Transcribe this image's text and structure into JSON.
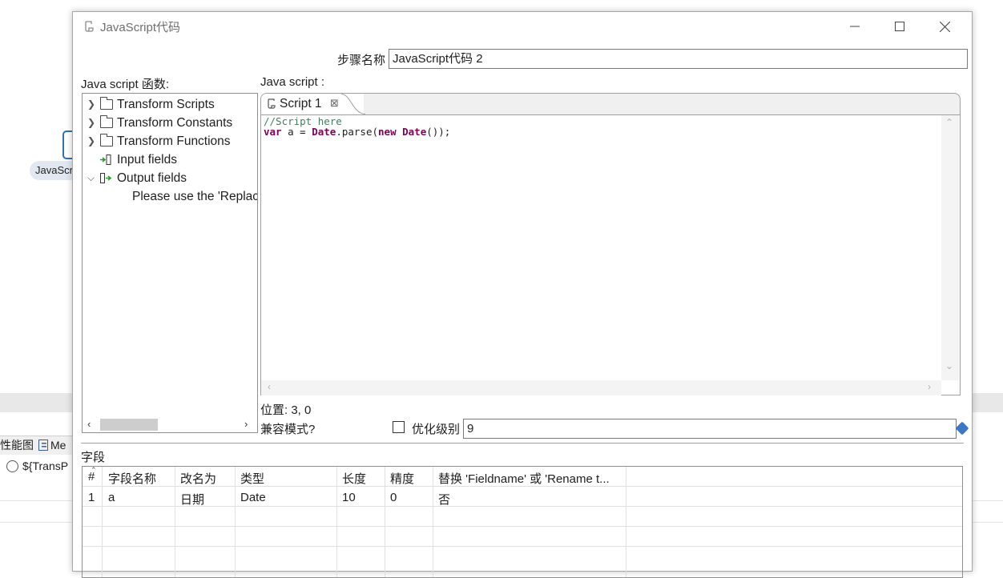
{
  "background": {
    "step_label": "JavaScript代码",
    "tab_label": "性能图",
    "tab2_label": "Me",
    "run_row_label": "${TransP"
  },
  "dialog": {
    "title": "JavaScript代码",
    "step_name_label": "步骤名称",
    "step_name_value": "JavaScript代码 2",
    "functions_label": "Java script 函数:",
    "javascript_label": "Java script :",
    "tree": {
      "items": [
        {
          "label": "Transform Scripts",
          "icon": "folder-icon",
          "expanded": false
        },
        {
          "label": "Transform Constants",
          "icon": "folder-icon",
          "expanded": false
        },
        {
          "label": "Transform Functions",
          "icon": "folder-icon",
          "expanded": false
        },
        {
          "label": "Input fields",
          "icon": "input-fields-icon"
        },
        {
          "label": "Output fields",
          "icon": "output-fields-icon",
          "expanded": true
        },
        {
          "label": "Please use the 'Replac"
        }
      ]
    },
    "editor": {
      "tab_label": "Script 1",
      "code_comment": "//Script here",
      "code_kw1": "var",
      "code_mid1": " a = ",
      "code_obj1": "Date",
      "code_mid2": ".parse(",
      "code_kw2": "new",
      "code_sp": " ",
      "code_obj2": "Date",
      "code_end": "());"
    },
    "position_text": "位置: 3, 0",
    "compat_label": "兼容模式?",
    "optimize_label": "优化级别",
    "optimize_value": "9",
    "optimize_checked": false,
    "fields_label": "字段",
    "table": {
      "headers": [
        "#",
        "字段名称",
        "改名为",
        "类型",
        "长度",
        "精度",
        "替换 'Fieldname' 或 'Rename t..."
      ],
      "rows": [
        [
          "1",
          "a",
          "日期",
          "Date",
          "10",
          "0",
          "否"
        ]
      ]
    }
  }
}
